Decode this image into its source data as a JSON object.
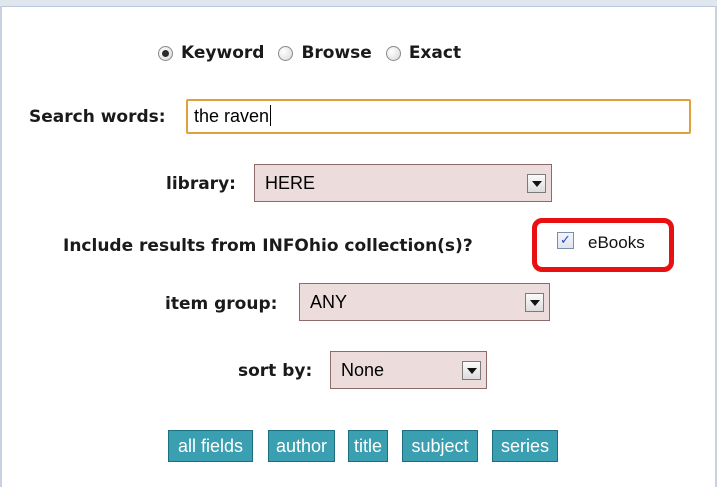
{
  "search_type": {
    "options": [
      {
        "label": "Keyword",
        "selected": true
      },
      {
        "label": "Browse",
        "selected": false
      },
      {
        "label": "Exact",
        "selected": false
      }
    ]
  },
  "search_words": {
    "label": "Search words:",
    "value": "the raven"
  },
  "library": {
    "label": "library:",
    "value": "HERE"
  },
  "infohio": {
    "label": "Include results from INFOhio collection(s)?",
    "option_label": "eBooks",
    "checked": true,
    "highlight_color": "#e81010"
  },
  "item_group": {
    "label": "item group:",
    "value": "ANY"
  },
  "sort_by": {
    "label": "sort by:",
    "value": "None"
  },
  "buttons": [
    "all fields",
    "author",
    "title",
    "subject",
    "series"
  ],
  "colors": {
    "button_bg": "#3a9fb1",
    "select_bg": "#ecdcdc",
    "input_border": "#e0a03c"
  }
}
